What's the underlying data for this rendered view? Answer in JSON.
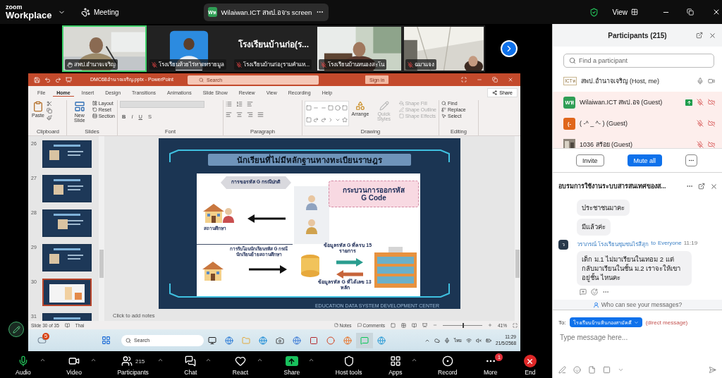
{
  "header": {
    "brand_small": "zoom",
    "brand": "Workplace",
    "meeting": "Meeting",
    "share_pill": {
      "avatar": "Wห",
      "title": "Wilaiwan.ICT สพป.อจ's screen"
    },
    "view": "View"
  },
  "video_tiles": [
    {
      "kind": "video",
      "name": "สพป.อำนาจเจริญ",
      "active": true,
      "muted": false
    },
    {
      "kind": "avatar",
      "name": "โรงเรียนห้วยไร่หาดทรายมูล",
      "active": false,
      "muted": true
    },
    {
      "kind": "name",
      "display": "โรงเรียนบ้านก่อ(ร...",
      "name": "โรงเรียนบ้านก่อ(รามคำแห...",
      "active": false,
      "muted": true
    },
    {
      "kind": "video",
      "name": "โรงเรียนบ้านหนองสะโน",
      "active": false,
      "muted": true
    },
    {
      "kind": "video",
      "name": "ฉมาแจง",
      "active": false,
      "muted": true
    }
  ],
  "powerpoint": {
    "file_title": "DMC68อำนาจเจริญ.pptx  -  PowerPoint",
    "search": {
      "placeholder": "Search"
    },
    "sign_in": "Sign in",
    "tabs": [
      {
        "label": "File",
        "selected": false
      },
      {
        "label": "Home",
        "selected": true
      },
      {
        "label": "Insert",
        "selected": false
      },
      {
        "label": "Design",
        "selected": false
      },
      {
        "label": "Transitions",
        "selected": false
      },
      {
        "label": "Animations",
        "selected": false
      },
      {
        "label": "Slide Show",
        "selected": false
      },
      {
        "label": "Review",
        "selected": false
      },
      {
        "label": "View",
        "selected": false
      },
      {
        "label": "Recording",
        "selected": false
      },
      {
        "label": "Help",
        "selected": false
      }
    ],
    "share": "Share",
    "ribbon": {
      "clipboard": {
        "label": "Clipboard",
        "paste": "Paste"
      },
      "slides": {
        "label": "Slides",
        "new_slide": "New Slide",
        "layout": "Layout",
        "reset": "Reset",
        "section": "Section"
      },
      "font": {
        "label": "Font",
        "buttons": [
          "B",
          "I",
          "U",
          "S"
        ]
      },
      "paragraph": {
        "label": "Paragraph"
      },
      "drawing": {
        "label": "Drawing",
        "arrange": "Arrange",
        "quick_styles": {
          "label": "Quick Styles",
          "disabled": true
        },
        "shape_fill": {
          "label": "Shape Fill",
          "disabled": true
        },
        "shape_outline": {
          "label": "Shape Outline",
          "disabled": true
        },
        "shape_effects": {
          "label": "Shape Effects",
          "disabled": true
        }
      },
      "editing": {
        "label": "Editing",
        "find": "Find",
        "replace": "Replace",
        "select": "Select"
      }
    },
    "thumbnails": [
      {
        "number": "26",
        "selected": false
      },
      {
        "number": "27",
        "selected": false
      },
      {
        "number": "28",
        "selected": false
      },
      {
        "number": "29",
        "selected": false
      },
      {
        "number": "30",
        "selected": true
      },
      {
        "number": "31",
        "selected": false
      }
    ],
    "slide": {
      "title": "นักเรียนที่ไม่มีหลักฐานทางทะเบียนราษฎร",
      "process_title": "กระบวนการออกรหัส",
      "process_code": "G Code",
      "normal_case": "การขอรหัส G กรณีปกติ",
      "school": "สถานศึกษา",
      "transfer_case": "การรับโอนนักเรียนรหัส G กรณีนักเรียนย้ายสถานศึกษา",
      "data_15": "ข้อมูลรหัส G ที่ครบ 15 รายการ",
      "data_13": "ข้อมูลรหัส G ที่ได้เลข 13 หลัก",
      "footer": "EDUCATION DATA SYSTEM DEVELOPMENT CENTER"
    },
    "notes_placeholder": "Click to add notes",
    "status": {
      "slide": "Slide 30 of 35",
      "language": "Thai",
      "notes": "Notes",
      "comments": "Comments",
      "zoom_slider": {
        "level": 0.5
      },
      "zoom": "41%"
    },
    "taskbar": {
      "weather_badge": "5",
      "search": "Search",
      "input_language": "ไทย",
      "time": "11:29",
      "date": "21/5/2568"
    }
  },
  "participants": {
    "title": "Participants (215)",
    "search": {
      "placeholder": "Find a participant"
    },
    "items": [
      {
        "kind": "logo",
        "avatar": "ICTห",
        "name": "สพป.อำนาจเจริญ (Host, me)",
        "muted": false,
        "video_off": false,
        "sharing": false
      },
      {
        "kind": "initials",
        "avatar": "Wห",
        "color": "#2f9e55",
        "name": "Wilaiwan.ICT สพป.อจ (Guest)",
        "muted": true,
        "video_off": true,
        "sharing": true
      },
      {
        "kind": "initials",
        "avatar": "(-",
        "color": "#e0661c",
        "name": "( -^ _ ^- ) (Guest)",
        "muted": true,
        "video_off": true,
        "sharing": false
      },
      {
        "kind": "picture",
        "name": "1036 สร้อย (Guest)",
        "muted": true,
        "video_off": true,
        "sharing": false
      }
    ],
    "invite": "Invite",
    "mute_all": "Mute all"
  },
  "chat": {
    "title": "อบรมการใช้งานระบบสารสนเทศของส...",
    "messages": [
      {
        "kind": "bubble",
        "text": "ประชาชนมาคะ"
      },
      {
        "kind": "bubble",
        "text": "มีแล้วค่ะ"
      },
      {
        "kind": "incoming",
        "avatar": "ว",
        "sender": "วราภรณ์ โรงเรียนชุมชนไร่สีสุก",
        "to": "to",
        "recipient": "Everyone",
        "time": "11:19",
        "text": "เด็ก ม.1 ไม่มาเรียนในเทอม 2 แต่ กลับมาเรียนในชั้น ม.2 เราจะให้เขาอยู่ชั้น ไหนคะ"
      }
    ],
    "who_can_see": "Who can see your messages?",
    "to_label": "To:",
    "recipient": "โรงเรียนบ้านหินกองสามัคคี",
    "direct": "(direct message)",
    "input": {
      "placeholder": "Type message here..."
    }
  },
  "toolbar": [
    {
      "kind": "audio",
      "label": "Audio",
      "caret": true
    },
    {
      "kind": "video",
      "label": "Video",
      "caret": true
    },
    {
      "kind": "participants",
      "label": "Participants",
      "count": "215",
      "caret": true
    },
    {
      "kind": "chat",
      "label": "Chat",
      "caret": true
    },
    {
      "kind": "react",
      "label": "React",
      "caret": true
    },
    {
      "kind": "share",
      "label": "Share",
      "caret": true
    },
    {
      "kind": "host",
      "label": "Host tools",
      "caret": false
    },
    {
      "kind": "apps",
      "label": "Apps",
      "caret": true
    },
    {
      "kind": "record",
      "label": "Record",
      "caret": false
    },
    {
      "kind": "more",
      "label": "More",
      "badge": "1",
      "caret": false
    },
    {
      "kind": "end",
      "label": "End",
      "caret": false
    }
  ]
}
